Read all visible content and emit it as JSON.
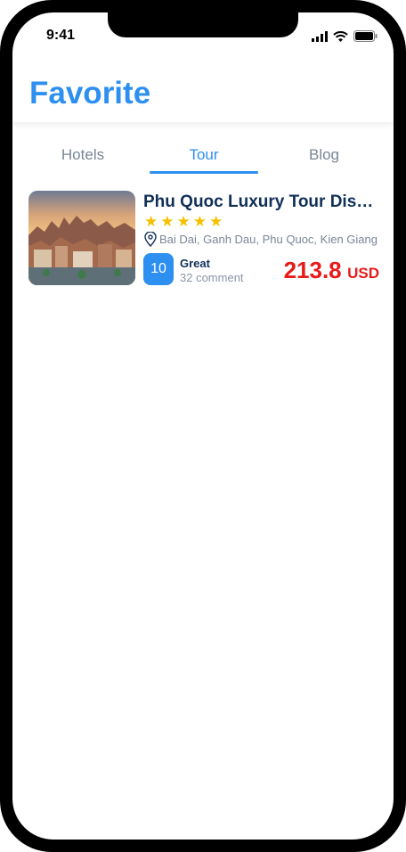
{
  "status_bar": {
    "time": "9:41"
  },
  "header": {
    "title": "Favorite"
  },
  "tabs": [
    {
      "label": "Hotels",
      "active": false
    },
    {
      "label": "Tour",
      "active": true
    },
    {
      "label": "Blog",
      "active": false
    }
  ],
  "items": [
    {
      "title": "Phu Quoc Luxury Tour Discount",
      "stars": 5,
      "location": "Bai Dai, Ganh Dau, Phu Quoc, Kien Giang",
      "rating": "10",
      "rating_label": "Great",
      "comments": "32 comment",
      "price": "213.8",
      "currency": "USD"
    }
  ],
  "colors": {
    "accent": "#2d8ff0",
    "price": "#e81a1a",
    "star": "#f5c000",
    "title": "#103058"
  }
}
